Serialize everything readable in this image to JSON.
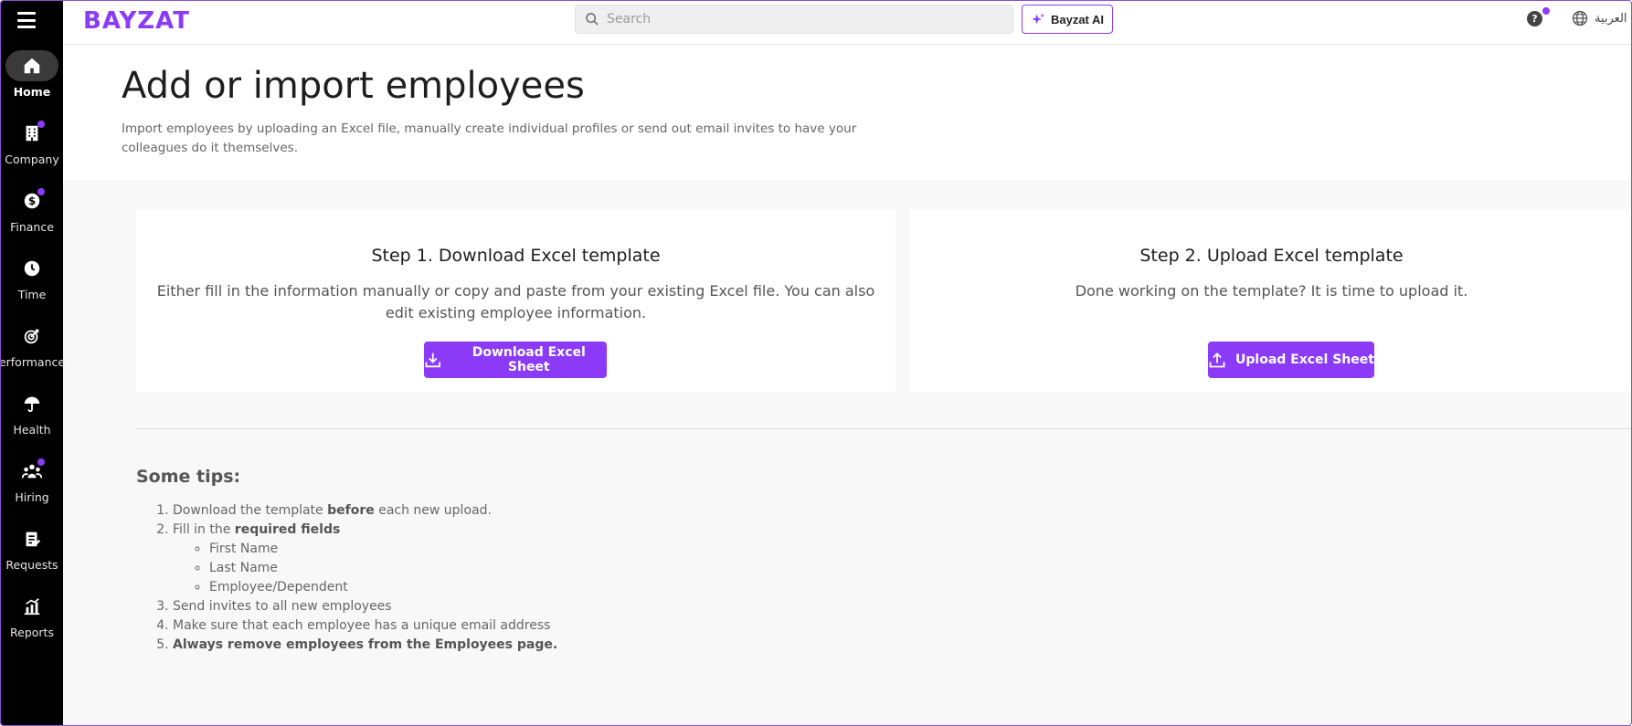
{
  "sidebar": {
    "items": [
      {
        "label": "Home",
        "icon": "home-icon",
        "active": true
      },
      {
        "label": "Company",
        "icon": "building-icon",
        "badge": true
      },
      {
        "label": "Finance",
        "icon": "dollar-icon",
        "badge": true
      },
      {
        "label": "Time",
        "icon": "clock-icon"
      },
      {
        "label": "erformance",
        "icon": "target-icon"
      },
      {
        "label": "Health",
        "icon": "umbrella-icon"
      },
      {
        "label": "Hiring",
        "icon": "people-icon",
        "badge": true
      },
      {
        "label": "Requests",
        "icon": "clipboard-icon"
      },
      {
        "label": "Reports",
        "icon": "chart-icon"
      }
    ]
  },
  "topbar": {
    "logo": "BAYZAT",
    "search_placeholder": "Search",
    "ai_label": "Bayzat AI",
    "help_label": "?",
    "language_label": "العربية"
  },
  "header": {
    "title": "Add or import employees",
    "description": "Import employees by uploading an Excel file, manually create individual profiles or send out email invites to have your colleagues do it themselves."
  },
  "steps": [
    {
      "title": "Step 1. Download Excel template",
      "text": "Either fill in the information manually or copy and paste from your existing Excel file. You can also edit existing employee information.",
      "button": "Download Excel Sheet"
    },
    {
      "title": "Step 2. Upload Excel template",
      "text": "Done working on the template? It is time to upload it.",
      "button": "Upload Excel Sheet"
    }
  ],
  "tips": {
    "title": "Some tips:",
    "t1_pre": "Download the template ",
    "t1_bold": "before",
    "t1_post": " each new upload.",
    "t2_pre": "Fill in the ",
    "t2_bold": "required fields",
    "fields": [
      "First Name",
      "Last Name",
      "Employee/Dependent"
    ],
    "t3": "Send invites to all new employees",
    "t4": "Make sure that each employee has a unique email address",
    "t5": "Always remove employees from the Employees page."
  },
  "colors": {
    "accent": "#8b3bf7",
    "sidebar": "#000000"
  }
}
